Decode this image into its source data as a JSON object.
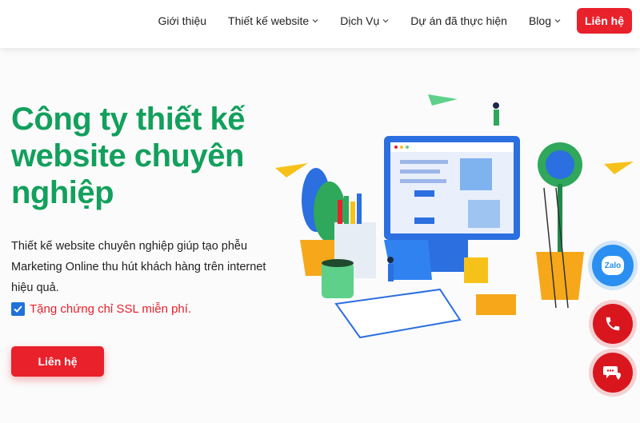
{
  "nav": {
    "items": [
      {
        "label": "Giới thiệu",
        "has_dropdown": false
      },
      {
        "label": "Thiết kế website",
        "has_dropdown": true
      },
      {
        "label": "Dịch Vụ",
        "has_dropdown": true
      },
      {
        "label": "Dự án đã thực hiện",
        "has_dropdown": false
      },
      {
        "label": "Blog",
        "has_dropdown": true
      }
    ],
    "cta_label": "Liên hệ"
  },
  "hero": {
    "headline_line1": "Công ty thiết kế",
    "headline_line2": "website chuyên",
    "headline_line3": "nghiệp",
    "description": "Thiết kế website chuyên nghiệp giúp tạo phễu Marketing Online thu hút khách hàng trên internet hiệu quả.",
    "ssl_text": "Tặng chứng chỉ SSL miễn phí.",
    "cta_label": "Liên hệ"
  },
  "floating": {
    "zalo_label": "Zalo"
  },
  "colors": {
    "brand_green": "#12a05c",
    "accent_red": "#e8212b",
    "zalo_blue": "#2a8ff0",
    "check_blue": "#1f73d8"
  }
}
